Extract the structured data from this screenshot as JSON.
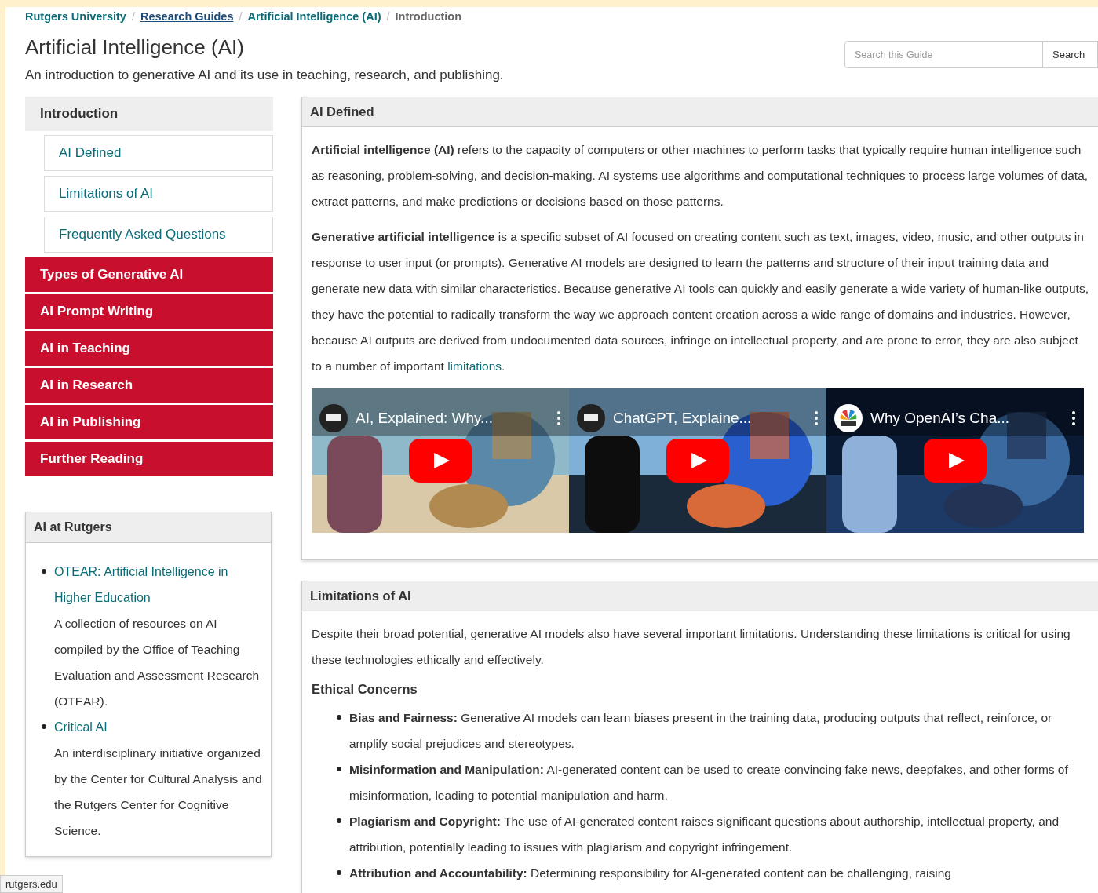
{
  "breadcrumb_separator": "/",
  "breadcrumb": [
    {
      "label": "Rutgers University",
      "kind": "link"
    },
    {
      "label": "Research Guides",
      "kind": "underlined"
    },
    {
      "label": "Artificial Intelligence (AI)",
      "kind": "link"
    },
    {
      "label": "Introduction",
      "kind": "current"
    }
  ],
  "title": "Artificial Intelligence (AI)",
  "description": "An introduction to generative AI and its use in teaching, research, and publishing.",
  "search": {
    "placeholder": "Search this Guide",
    "button": "Search"
  },
  "nav": [
    {
      "label": "Introduction",
      "selected": true,
      "children": [
        {
          "label": "AI Defined"
        },
        {
          "label": "Limitations of AI"
        },
        {
          "label": "Frequently Asked Questions"
        }
      ]
    },
    {
      "label": "Types of Generative AI",
      "selected": false
    },
    {
      "label": "AI Prompt Writing",
      "selected": false
    },
    {
      "label": "AI in Teaching",
      "selected": false
    },
    {
      "label": "AI in Research",
      "selected": false
    },
    {
      "label": "AI in Publishing",
      "selected": false
    },
    {
      "label": "Further Reading",
      "selected": false
    }
  ],
  "side_box": {
    "title": "AI at Rutgers",
    "items": [
      {
        "link": "OTEAR: Artificial Intelligence in Higher Education",
        "description": "A collection of resources on AI compiled by the Office of Teaching Evaluation and Assessment Research (OTEAR)."
      },
      {
        "link": "Critical AI",
        "description": "An interdisciplinary initiative organized by the Center for Cultural Analysis and the Rutgers Center for Cognitive Science."
      }
    ]
  },
  "sections": [
    {
      "title": "AI Defined",
      "paragraphs": [
        {
          "text": "**Artificial intelligence (AI)** refers to the capacity of computers or other machines to perform tasks that typically require human intelligence such as reasoning, problem-solving, and decision-making. AI systems use algorithms and computational techniques to process large volumes of data, extract patterns, and make predictions or decisions based on those patterns."
        },
        {
          "text": "**Generative artificial intelligence** is a specific subset of AI focused on creating content such as text, images, video, music, and other outputs in response to user input (or prompts). Generative AI models are designed to learn the patterns and structure of their input training data and generate new data with similar characteristics. Because generative AI tools can quickly and easily generate a wide variety of human-like outputs, they have the potential to radically transform the way we approach content creation across a wide range of domains and industries. However, because AI outputs are derived from undocumented data sources, infringe on intellectual property, and are prone to error, they are also subject to a number of important ",
          "link": "limitations",
          "after": "."
        }
      ],
      "videos": [
        {
          "title": "AI, Explained: Why...",
          "kind": "wsj"
        },
        {
          "title": "ChatGPT, Explaine...",
          "kind": "wsj"
        },
        {
          "title": "Why OpenAI’s Cha...",
          "kind": "cnbc"
        }
      ]
    },
    {
      "title": "Limitations of AI",
      "paragraphs": [
        {
          "text": "Despite their broad potential, generative AI models also have several important limitations. Understanding these limitations is critical for using these technologies ethically and effectively."
        }
      ],
      "subheading": "Ethical Concerns",
      "bullets": [
        {
          "term": "Bias and Fairness:",
          "text": "Generative AI models can learn biases present in the training data, producing outputs that reflect, reinforce, or amplify social prejudices and stereotypes."
        },
        {
          "term": "Misinformation and Manipulation:",
          "text": "AI-generated content can be used to create convincing fake news, deepfakes, and other forms of misinformation, leading to potential manipulation and harm."
        },
        {
          "term": "Plagiarism and Copyright:",
          "text": "The use of AI-generated content raises significant questions about authorship, intellectual property, and attribution, potentially leading to issues with plagiarism and copyright infringement."
        },
        {
          "term": "Attribution and Accountability:",
          "text": "Determining responsibility for AI-generated content can be challenging, raising"
        }
      ]
    }
  ],
  "status_url": "rutgers.edu"
}
